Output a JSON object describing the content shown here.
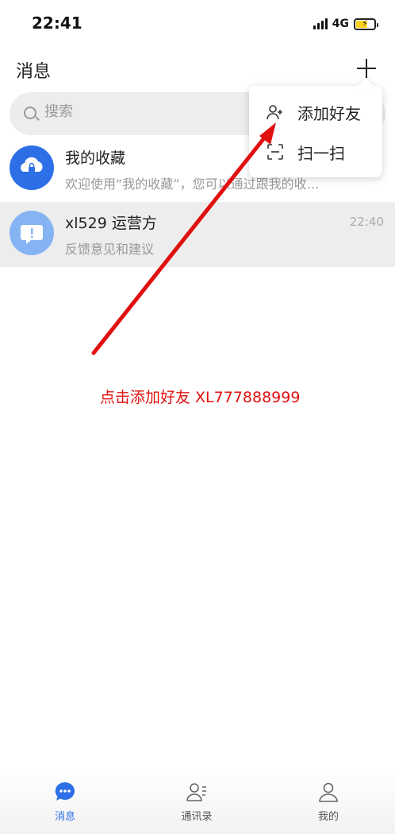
{
  "status_bar": {
    "time": "22:41",
    "network": "4G"
  },
  "header": {
    "title": "消息"
  },
  "search": {
    "placeholder": "搜索"
  },
  "conversations": [
    {
      "title": "我的收藏",
      "subtitle": "欢迎使用“我的收藏”，您可以通过跟我的收…",
      "time": ""
    },
    {
      "title": "xl529 运营方",
      "subtitle": "反馈意见和建议",
      "time": "22:40"
    }
  ],
  "popup_menu": {
    "items": [
      {
        "label": "添加好友",
        "icon": "add-friend-icon"
      },
      {
        "label": "扫一扫",
        "icon": "scan-icon"
      }
    ]
  },
  "annotation": {
    "text": "点击添加好友 XL777888999",
    "color": "#e01010"
  },
  "tabbar": {
    "tabs": [
      {
        "label": "消息",
        "icon": "chat-icon",
        "active": true
      },
      {
        "label": "通讯录",
        "icon": "contacts-icon",
        "active": false
      },
      {
        "label": "我的",
        "icon": "profile-icon",
        "active": false
      }
    ]
  },
  "colors": {
    "accent": "#2d6fe6",
    "annotation": "#e01010"
  }
}
